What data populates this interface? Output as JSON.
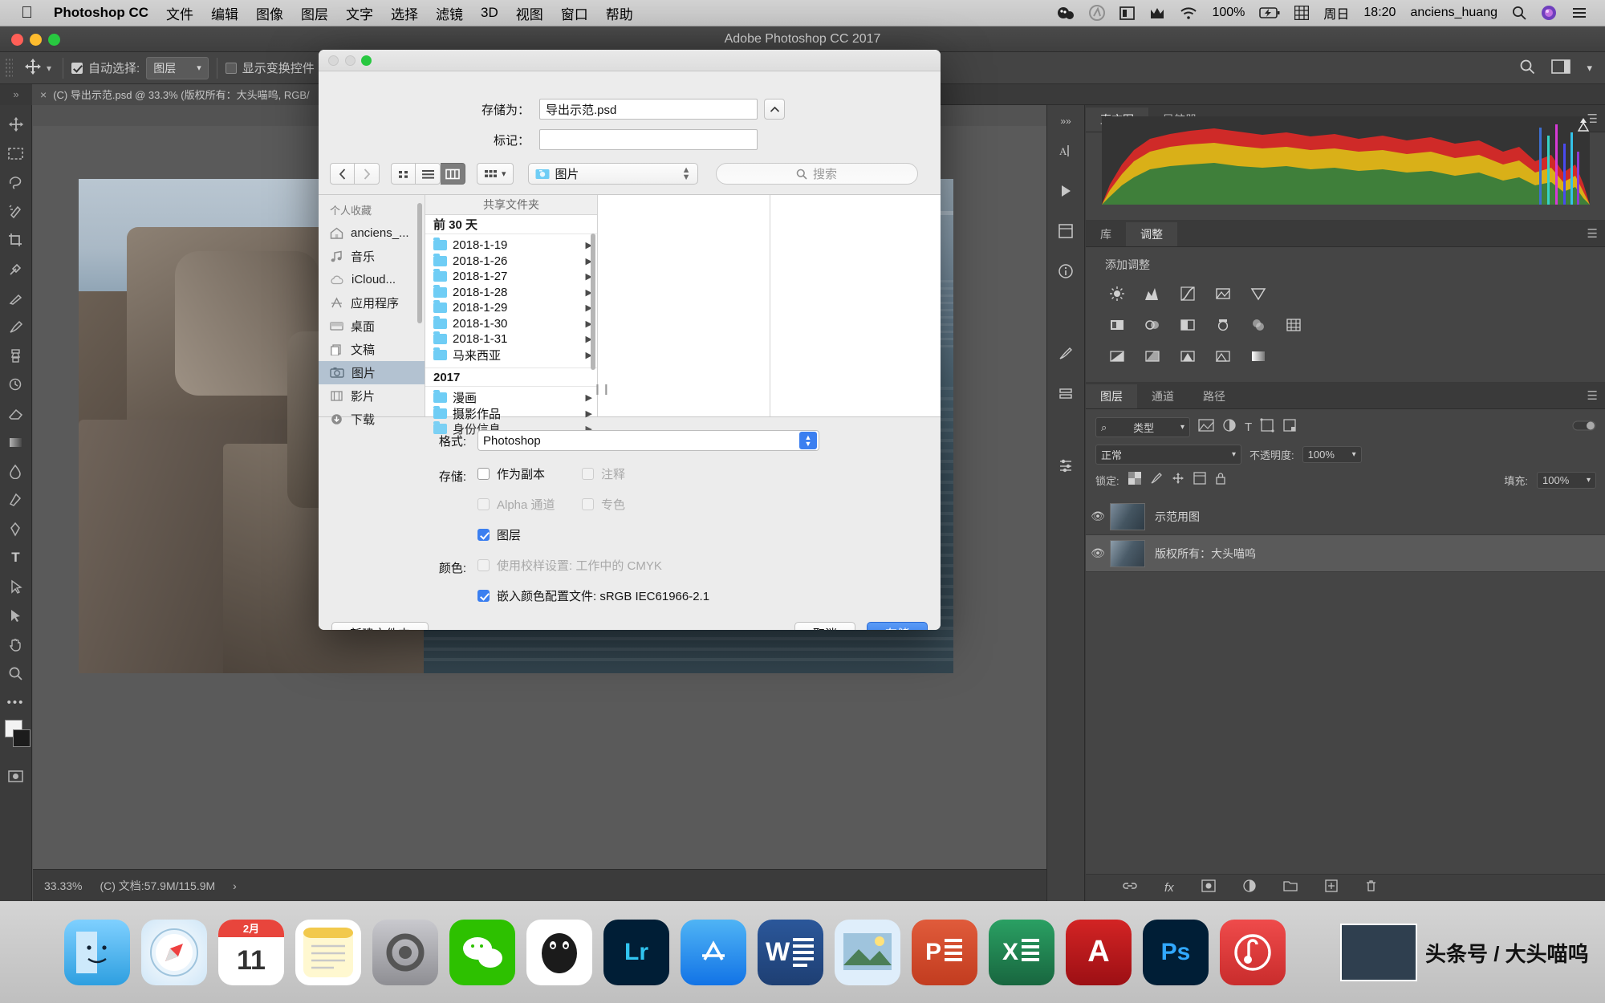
{
  "menubar": {
    "apple": "apple-logo",
    "app_name": "Photoshop CC",
    "items": [
      "文件",
      "编辑",
      "图像",
      "图层",
      "文字",
      "选择",
      "滤镜",
      "3D",
      "视图",
      "窗口",
      "帮助"
    ],
    "status": {
      "battery_percent": "100%",
      "day": "周日",
      "time": "18:20",
      "user": "anciens_huang"
    }
  },
  "photoshop": {
    "window_title": "Adobe Photoshop CC 2017",
    "options_bar": {
      "auto_select_label": "自动选择:",
      "auto_select_value": "图层",
      "auto_select_checked": true,
      "show_transform_label": "显示变换控件",
      "show_transform_checked": false
    },
    "document_tab": "(C) 导出示范.psd @ 33.3% (版权所有：大头喵呜, RGB/",
    "status_bar": {
      "zoom": "33.33%",
      "doc_size": "(C) 文档:57.9M/115.9M"
    },
    "panels": {
      "top_tabs": [
        "直方图",
        "导航器"
      ],
      "top_active": "直方图",
      "adjust_tabs": [
        "库",
        "调整"
      ],
      "adjust_active": "调整",
      "adjust_title": "添加调整",
      "layers_tabs": [
        "图层",
        "通道",
        "路径"
      ],
      "layers_active": "图层",
      "filter_value": "类型",
      "blend_mode": "正常",
      "opacity_label": "不透明度:",
      "opacity_value": "100%",
      "lock_label": "锁定:",
      "fill_label": "填充:",
      "fill_value": "100%",
      "layers": [
        {
          "name": "示范用图",
          "visible": true
        },
        {
          "name": "版权所有：大头喵呜",
          "visible": true,
          "selected": true
        }
      ]
    }
  },
  "save_dialog": {
    "save_as_label": "存储为：",
    "save_as_value": "导出示范.psd",
    "tags_label": "标记：",
    "tags_value": "",
    "tags_placeholder": "",
    "nav": {
      "back": "chevron-left-icon",
      "forward": "chevron-right-icon",
      "view_icon": "icon-view",
      "view_list": "list-view",
      "view_column": "column-view",
      "view_gallery": "group-view",
      "path_value": "图片",
      "search_placeholder": "搜索"
    },
    "sidebar": {
      "header": "个人收藏",
      "items": [
        {
          "label": "anciens_...",
          "icon": "home-icon"
        },
        {
          "label": "音乐",
          "icon": "music-note-icon"
        },
        {
          "label": "iCloud...",
          "icon": "cloud-icon"
        },
        {
          "label": "应用程序",
          "icon": "applications-icon"
        },
        {
          "label": "桌面",
          "icon": "desktop-icon"
        },
        {
          "label": "文稿",
          "icon": "documents-icon"
        },
        {
          "label": "图片",
          "icon": "camera-icon",
          "selected": true
        },
        {
          "label": "影片",
          "icon": "film-icon"
        },
        {
          "label": "下载",
          "icon": "download-icon"
        }
      ]
    },
    "column1": {
      "header": "共享文件夹",
      "groups": [
        {
          "title": "前 30 天",
          "items": [
            "2018-1-19",
            "2018-1-26",
            "2018-1-27",
            "2018-1-28",
            "2018-1-29",
            "2018-1-30",
            "2018-1-31",
            "马来西亚"
          ]
        },
        {
          "title": "2017",
          "items": [
            "漫画",
            "摄影作品",
            "身份信息"
          ]
        }
      ]
    },
    "options": {
      "format_label": "格式:",
      "format_value": "Photoshop",
      "save_label": "存储:",
      "color_label": "颜色:",
      "checkboxes": [
        {
          "label": "作为副本",
          "checked": false,
          "disabled": false
        },
        {
          "label": "注释",
          "checked": false,
          "disabled": true
        },
        {
          "label": "Alpha 通道",
          "checked": false,
          "disabled": true
        },
        {
          "label": "专色",
          "checked": false,
          "disabled": true
        },
        {
          "label": "图层",
          "checked": true,
          "disabled": false
        },
        {
          "label": "使用校样设置: 工作中的 CMYK",
          "checked": false,
          "disabled": true
        },
        {
          "label": "嵌入颜色配置文件: sRGB IEC61966-2.1",
          "checked": true,
          "disabled": false
        }
      ]
    },
    "footer": {
      "new_folder": "新建文件夹",
      "cancel": "取消",
      "save": "存储"
    }
  },
  "dock": {
    "apps": [
      {
        "name": "finder",
        "label": "",
        "color": "#3aa0e8"
      },
      {
        "name": "safari",
        "label": "",
        "color": "#e8f3fb"
      },
      {
        "name": "calendar",
        "label": "11",
        "color": "#ffffff",
        "sub": "2月"
      },
      {
        "name": "notes",
        "label": "",
        "color": "#fff2b2"
      },
      {
        "name": "system-preferences",
        "label": "",
        "color": "#8e8e93"
      },
      {
        "name": "wechat",
        "label": "",
        "color": "#2dc100"
      },
      {
        "name": "qq",
        "label": "",
        "color": "#12b7f5"
      },
      {
        "name": "lightroom",
        "label": "Lr",
        "color": "#001e36"
      },
      {
        "name": "app-store",
        "label": "",
        "color": "#1f8ef5"
      },
      {
        "name": "word",
        "label": "W",
        "color": "#2b579a"
      },
      {
        "name": "preview",
        "label": "",
        "color": "#cfe3f5"
      },
      {
        "name": "powerpoint",
        "label": "P",
        "color": "#d24726"
      },
      {
        "name": "excel",
        "label": "X",
        "color": "#217346"
      },
      {
        "name": "autocad",
        "label": "A",
        "color": "#b3141c"
      },
      {
        "name": "photoshop",
        "label": "Ps",
        "color": "#001e36"
      },
      {
        "name": "netease-music",
        "label": "",
        "color": "#e53a3a"
      }
    ]
  },
  "watermark": {
    "text": "头条号 / 大头喵呜"
  }
}
